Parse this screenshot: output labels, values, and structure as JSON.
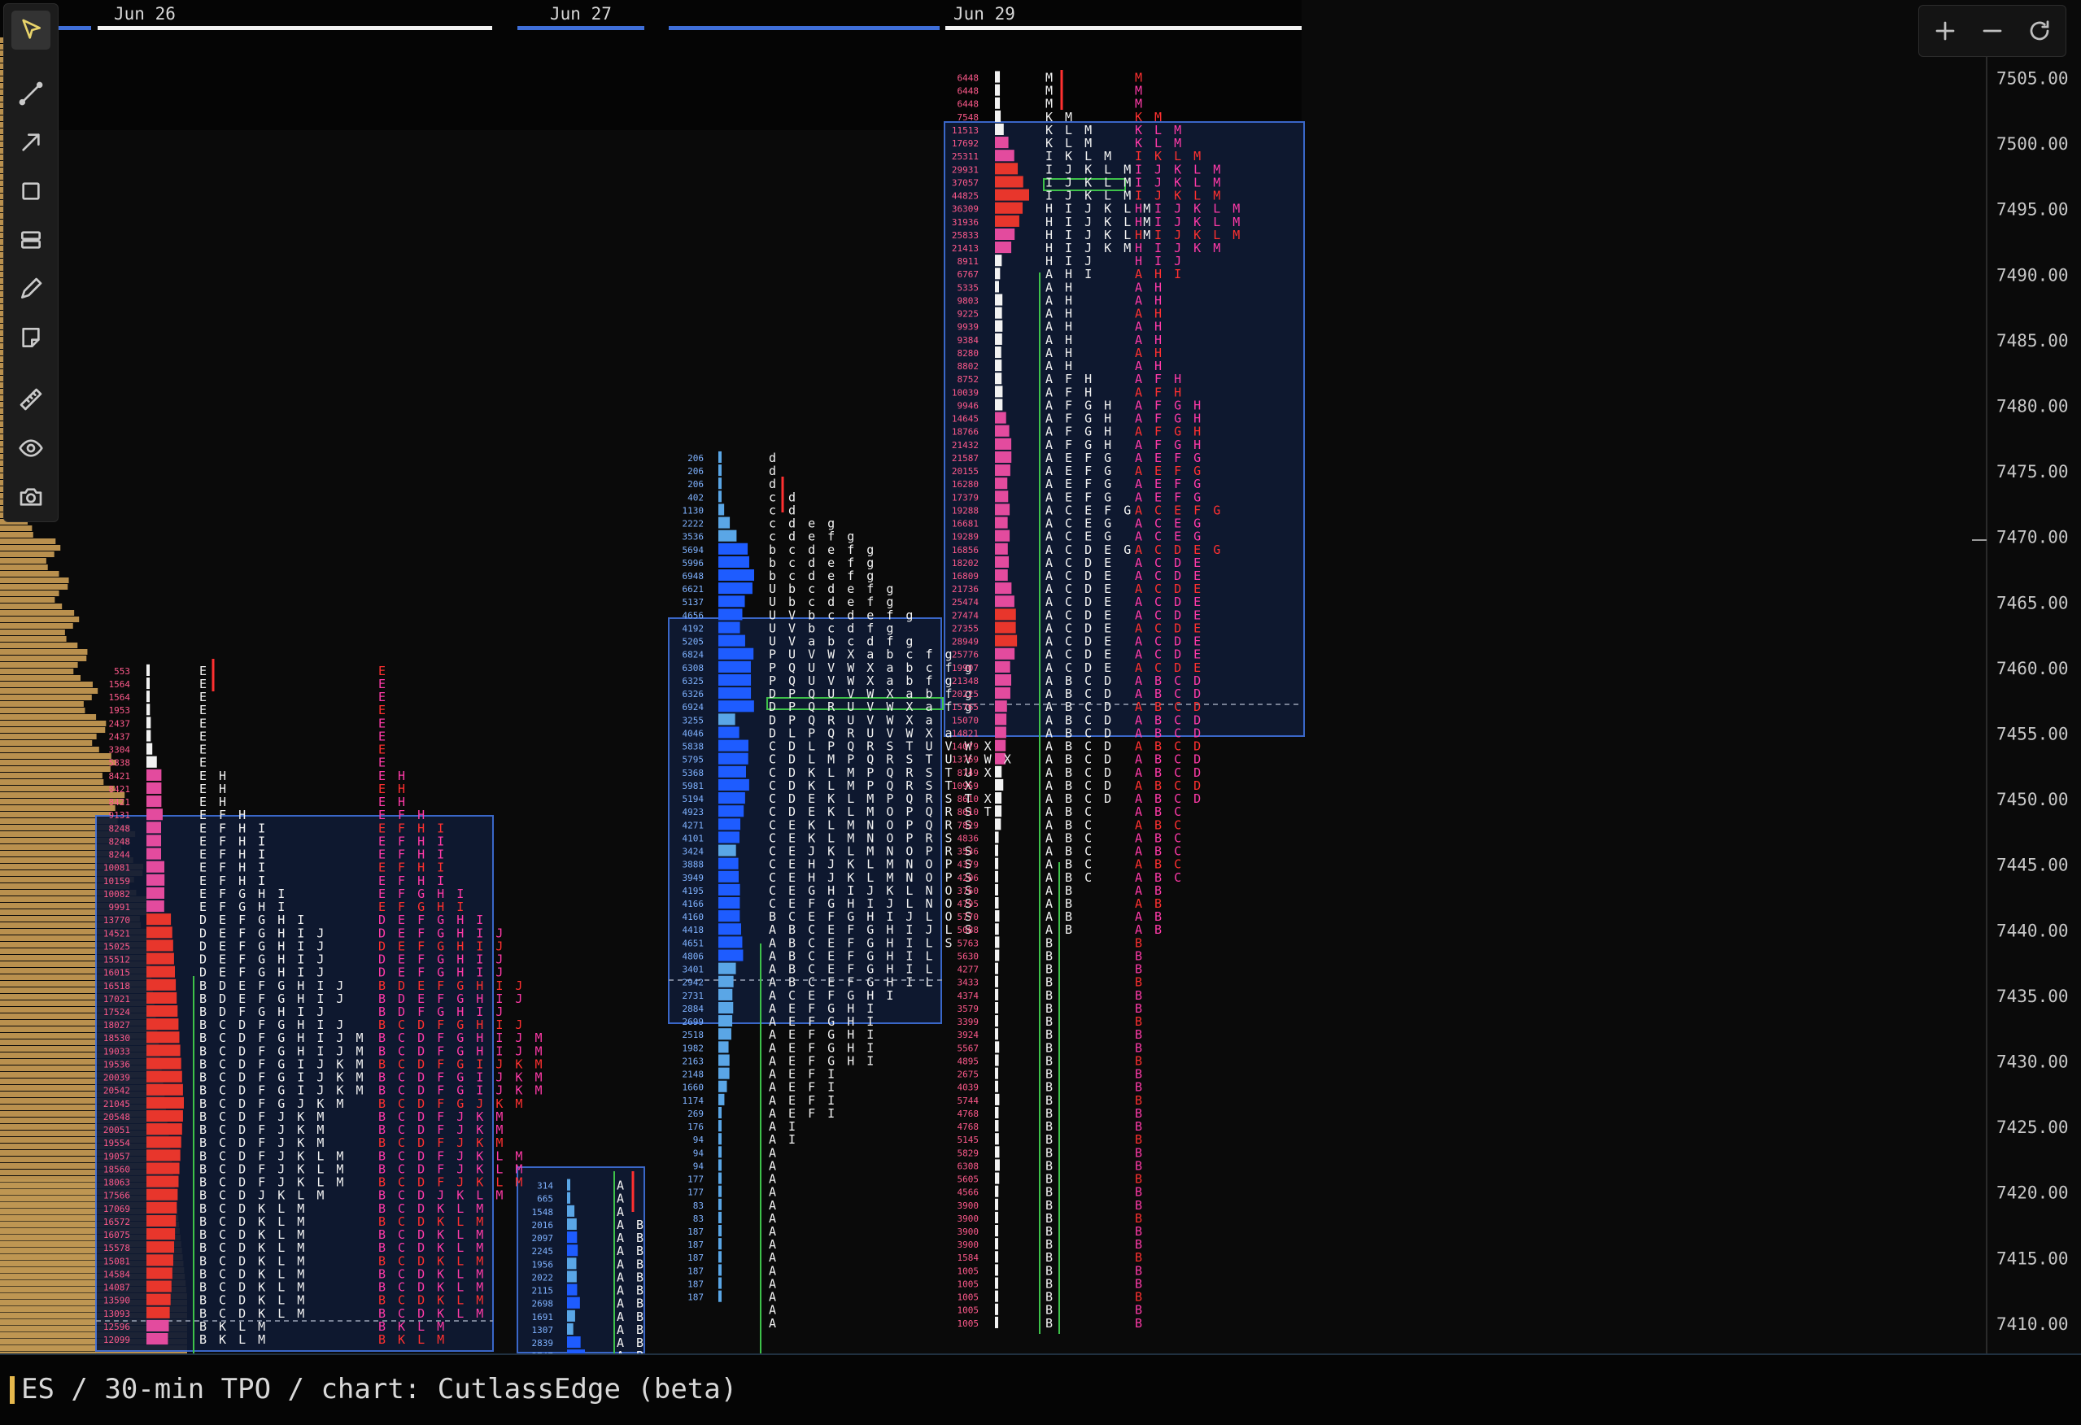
{
  "app": {
    "status_line": "ES / 30-min TPO / chart: CutlassEdge (beta)"
  },
  "toolbar": {
    "tools": [
      {
        "name": "pointer-icon",
        "active": true
      },
      {
        "name": "line-icon"
      },
      {
        "name": "arrow-icon"
      },
      {
        "name": "rectangle-icon"
      },
      {
        "name": "range-icon"
      },
      {
        "name": "pencil-icon"
      },
      {
        "name": "note-icon"
      },
      {
        "name": "ruler-icon"
      },
      {
        "name": "eye-icon"
      },
      {
        "name": "camera-icon"
      }
    ]
  },
  "zoom_controls": [
    {
      "name": "zoom-in-icon"
    },
    {
      "name": "zoom-out-icon"
    },
    {
      "name": "reset-icon"
    }
  ],
  "colors": {
    "background": "#0a0a0a",
    "value_area": "#0f1a33",
    "value_area_border": "#3f6fd9",
    "poc_red": "#e8362c",
    "high_pink": "#e34b9e",
    "low_white": "#f2f2f2",
    "blue_profile": "#1e5cff",
    "light_blue": "#5aa6e6",
    "gold": "#d8a85a",
    "green": "#3ec24a",
    "yellow": "#e6c034",
    "magenta_letter": "#ff3aa8",
    "red_letter": "#ff3030"
  },
  "price_axis": {
    "labels": [
      "7505.00",
      "7500.00",
      "7495.00",
      "7490.00",
      "7485.00",
      "7480.00",
      "7475.00",
      "7470.00",
      "7465.00",
      "7460.00",
      "7455.00",
      "7450.00",
      "7445.00",
      "7440.00",
      "7435.00",
      "7430.00",
      "7425.00",
      "7420.00",
      "7415.00",
      "7410.00"
    ],
    "max": 7505,
    "min": 7410
  },
  "time_axis": {
    "labels": [
      "Jun 26",
      "Jun 27",
      "Jun 29"
    ]
  },
  "profiles": [
    {
      "id": "jun26",
      "top_price": 7460.25,
      "tpo_top": [
        "E",
        "E",
        "E",
        "E",
        "E",
        "E",
        "E",
        "E",
        "EH",
        "EH",
        "EH",
        "EFH",
        "EFHI",
        "EFHI",
        "EFHI",
        "EFHI",
        "EFHI",
        "EFGHI",
        "EFGHI",
        "DEFGHI",
        "DEFGHIJ",
        "DEFGHIJ",
        "DEFGHIJ",
        "DEFGHIJ",
        "BDEFGHIJ",
        "BDEFGHIJ",
        "BDFGHIJ",
        "BCDFGHIJ",
        "BCDFGHIJM",
        "BCDFGHIJM",
        "BCDFGIJKM",
        "BCDFGIJKM",
        "BCDFGIJKM",
        "BCDFGJKM",
        "BCDFJKM",
        "BCDFJKM",
        "BCDFJKM",
        "BCDFJKLM",
        "BCDFJKLM",
        "BCDFJKLM",
        "BCDJKLM",
        "BCDKLM",
        "BCDKLM",
        "BCDKLM",
        "BCDKLM",
        "BCDKLM",
        "BCDKLM",
        "BCDKLM",
        "BCDKLM",
        "BCDKLM",
        "BKLM",
        "BKLM"
      ],
      "tpo_right": [
        "E",
        "E",
        "E",
        "E",
        "E",
        "E",
        "E",
        "E",
        "EH",
        "EH",
        "EH",
        "EFH",
        "EFHI",
        "EFHI",
        "EFHI",
        "EFHI",
        "EFHI",
        "EFGHI",
        "EFGHI",
        "DEFGHI",
        "DEFGHIJ",
        "DEFGHIJ",
        "DEFGHIJ",
        "DEFGHIJ",
        "BDEFGHIJ",
        "BDEFGHIJ",
        "BDFGHIJ",
        "BCDFGHIJ",
        "BCDFGHIJM",
        "BCDFGHIJM",
        "BCDFGIJKM",
        "BCDFGIJKM",
        "BCDFGIJKM",
        "BCDFGJKM",
        "BCDFJKM",
        "BCDFJKM",
        "BCDFJKM",
        "BCDFJKLM",
        "BCDFJKLM",
        "BCDFJKLM",
        "BCDJKLM",
        "BCDKLM",
        "BCDKLM",
        "BCDKLM",
        "BCDKLM",
        "BCDKLM",
        "BCDKLM",
        "BCDKLM",
        "BCDKLM",
        "BCDKLM",
        "BKLM",
        "BKLM"
      ],
      "volumes": [
        "553",
        "1564",
        "1564",
        "1953",
        "2437",
        "2437",
        "3304",
        "5838",
        "8421",
        "8421",
        "8421",
        "9131",
        "8248",
        "8248",
        "8244",
        "10081",
        "10159",
        "10082",
        "9991",
        "13770",
        "14521",
        "15025",
        "15512",
        "16015",
        "16518",
        "17021",
        "17524",
        "18027",
        "18530",
        "19033",
        "19536",
        "20039",
        "20542",
        "21045",
        "20548",
        "20051",
        "19554",
        "19057",
        "18560",
        "18063",
        "17566",
        "17069",
        "16572",
        "16075",
        "15578",
        "15081",
        "14584",
        "14087",
        "13590",
        "13093",
        "12596",
        "12099"
      ]
    },
    {
      "id": "jun27_early",
      "top_price": 7421.0,
      "tpo_top": [
        "A",
        "A",
        "A",
        "AB",
        "AB",
        "AB",
        "AB",
        "AB",
        "AB",
        "AB",
        "AB",
        "AB",
        "AB",
        "AB"
      ],
      "volumes": [
        "314",
        "665",
        "1548",
        "2016",
        "2097",
        "2245",
        "1956",
        "2022",
        "2115",
        "2698",
        "1691",
        "1307",
        "2839",
        "3747"
      ]
    },
    {
      "id": "jun27_main",
      "top_price": 7476.5,
      "tpo_top": [
        "d",
        "d",
        "d",
        "cd",
        "cd",
        "cdeg",
        "cdefg",
        "bcdefg",
        "bcdefg",
        "bcdefg",
        "Ubcdefg",
        "Ubcdefg",
        "UVbcdefg",
        "UVbcdfg",
        "UVabcdfg",
        "PUVWXabcfg",
        "PQUVWXabcfg",
        "PQUVWXabfg",
        "DPQUVWXabfg",
        "DPQRUVWXafg",
        "DPQRUVWXa",
        "DLPQRUVWXa",
        "CDLPQRSTUVWX",
        "CDLMPQRSTUVWX",
        "CDKLMPQRSTUX",
        "CDKLMPQRSTX",
        "CDEKLMPQRSTX",
        "CDEKLMOPQRST",
        "CEKLMNOPQRS",
        "CEKLMNOPRS",
        "CEJKLMNOPRS",
        "CEHJKLMNOPS",
        "CEHJKLMNOPS",
        "CEGHIJKLNOS",
        "CEFGHIJLNOS",
        "BCEFGHIJLOS",
        "ABCEFGHIJLS",
        "ABCEFGHILS",
        "ABCEFGHIL",
        "ABCEFGHIL",
        "ABCEFGHIL",
        "ACEFGHI",
        "AEFGHI",
        "AEFGHI",
        "AEFGHI",
        "AEFGHI",
        "AEFGHI",
        "AEFI",
        "AEFI",
        "AEFI",
        "AEFI",
        "AI",
        "AI",
        "A",
        "A",
        "A",
        "A",
        "A",
        "A",
        "A",
        "A",
        "A",
        "A",
        "A",
        "A",
        "A",
        "A"
      ],
      "volumes": [
        "206",
        "206",
        "206",
        "402",
        "1130",
        "2222",
        "3536",
        "5694",
        "5996",
        "6948",
        "6621",
        "5137",
        "4656",
        "4192",
        "5205",
        "6824",
        "6308",
        "6325",
        "6326",
        "6924",
        "3255",
        "4046",
        "5838",
        "5795",
        "5368",
        "5981",
        "5194",
        "4923",
        "4271",
        "4101",
        "3424",
        "3888",
        "3949",
        "4195",
        "4166",
        "4160",
        "4418",
        "4651",
        "4806",
        "3401",
        "2942",
        "2731",
        "2884",
        "2699",
        "2518",
        "1982",
        "2163",
        "2148",
        "1660",
        "1174",
        "269",
        "176",
        "94",
        "94",
        "94",
        "177",
        "177",
        "83",
        "83",
        "187",
        "187",
        "187",
        "187",
        "187",
        "187"
      ]
    },
    {
      "id": "jun29",
      "top_price": 7505.5,
      "tpo_top": [
        "M",
        "M",
        "M",
        "KM",
        "KLM",
        "KLM",
        "IKLM",
        "IJKLM",
        "IJKLM",
        "IJKLM",
        "HIJKLM",
        "HIJKLM",
        "HIJKLM",
        "HIJKM",
        "HIJ",
        "AHI",
        "AH",
        "AH",
        "AH",
        "AH",
        "AH",
        "AH",
        "AH",
        "AFH",
        "AFH",
        "AFGH",
        "AFGH",
        "AFGH",
        "AFGH",
        "AEFG",
        "AEFG",
        "AEFG",
        "AEFG",
        "ACEFG",
        "ACEG",
        "ACEG",
        "ACDEG",
        "ACDE",
        "ACDE",
        "ACDE",
        "ACDE",
        "ACDE",
        "ACDE",
        "ACDE",
        "ACDE",
        "ACDE",
        "ABCD",
        "ABCD",
        "ABCD",
        "ABCD",
        "ABCD",
        "ABCD",
        "ABCD",
        "ABCD",
        "ABCD",
        "ABCD",
        "ABC",
        "ABC",
        "ABC",
        "ABC",
        "ABC",
        "ABC",
        "AB",
        "AB",
        "AB",
        "AB",
        "B",
        "B",
        "B",
        "B",
        "B",
        "B",
        "B",
        "B",
        "B",
        "B",
        "B",
        "B",
        "B",
        "B",
        "B",
        "B",
        "B",
        "B",
        "B",
        "B",
        "B",
        "B",
        "B",
        "B",
        "B",
        "B",
        "B",
        "B",
        "B",
        "B"
      ],
      "volumes": [
        "6448",
        "6448",
        "6448",
        "7548",
        "11513",
        "17692",
        "25311",
        "29931",
        "37057",
        "44825",
        "36309",
        "31936",
        "25833",
        "21413",
        "8911",
        "6767",
        "5335",
        "9803",
        "9225",
        "9939",
        "9384",
        "8280",
        "8802",
        "8752",
        "10039",
        "9946",
        "14645",
        "18766",
        "21432",
        "21587",
        "20155",
        "16280",
        "17379",
        "19288",
        "16681",
        "19289",
        "16856",
        "18202",
        "16809",
        "21736",
        "25474",
        "27474",
        "27355",
        "28949",
        "25776",
        "19907",
        "21348",
        "20225",
        "15765",
        "15070",
        "14821",
        "14079",
        "13769",
        "8749",
        "10959",
        "8610",
        "8610",
        "7829",
        "4836",
        "3536",
        "4379",
        "4206",
        "3760",
        "4795",
        "5770",
        "5088",
        "5763",
        "5630",
        "4277",
        "3433",
        "4374",
        "3579",
        "3399",
        "3924",
        "5567",
        "4895",
        "2675",
        "4039",
        "5744",
        "4768",
        "4768",
        "5145",
        "5829",
        "6308",
        "5605",
        "4566",
        "3900",
        "3900",
        "3900",
        "3900",
        "1584",
        "1005",
        "1005",
        "1005",
        "1005",
        "1005"
      ]
    }
  ]
}
